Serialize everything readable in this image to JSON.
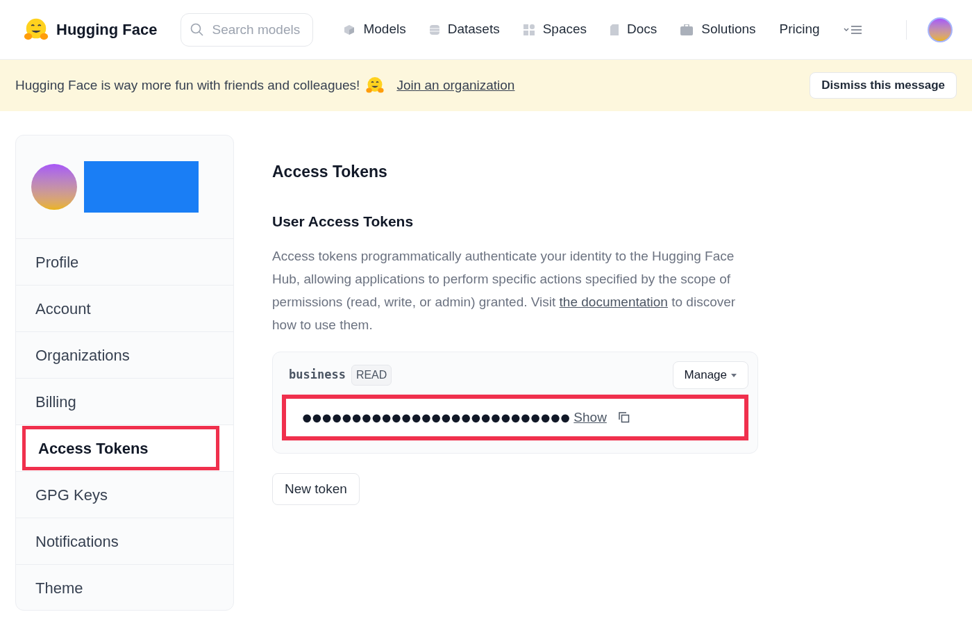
{
  "header": {
    "brand": "Hugging Face",
    "search": {
      "placeholder": "Search models"
    },
    "nav": [
      {
        "label": "Models",
        "kind": "models"
      },
      {
        "label": "Datasets",
        "kind": "datasets"
      },
      {
        "label": "Spaces",
        "kind": "spaces"
      },
      {
        "label": "Docs",
        "kind": "docs"
      },
      {
        "label": "Solutions",
        "kind": "solutions"
      },
      {
        "label": "Pricing",
        "kind": "none"
      }
    ]
  },
  "banner": {
    "text": "Hugging Face is way more fun with friends and colleagues!",
    "link": "Join an organization",
    "button": "Dismiss this message"
  },
  "sidebar": {
    "items": [
      {
        "label": "Profile",
        "selected": false,
        "highlighted": false
      },
      {
        "label": "Account",
        "selected": false,
        "highlighted": false
      },
      {
        "label": "Organizations",
        "selected": false,
        "highlighted": false
      },
      {
        "label": "Billing",
        "selected": false,
        "highlighted": false
      },
      {
        "label": "Access Tokens",
        "selected": true,
        "highlighted": true
      },
      {
        "label": "GPG Keys",
        "selected": false,
        "highlighted": false
      },
      {
        "label": "Notifications",
        "selected": false,
        "highlighted": false
      },
      {
        "label": "Theme",
        "selected": false,
        "highlighted": false
      }
    ]
  },
  "main": {
    "title": "Access Tokens",
    "subtitle": "User Access Tokens",
    "description": "Access tokens programmatically authenticate your identity to the Hugging Face Hub, allowing applications to perform specific actions specified by the scope of permissions (read, write, or admin) granted. Visit",
    "link": "the documentation",
    "description_end": "to discover how to use them.",
    "token": {
      "name": "business",
      "role": "READ",
      "manage": "Manage",
      "value": "●●●●●●●●●●●●●●●●●●●●●●●●●●●",
      "show": "Show",
      "highlighted": true
    },
    "new_token": "New token"
  }
}
